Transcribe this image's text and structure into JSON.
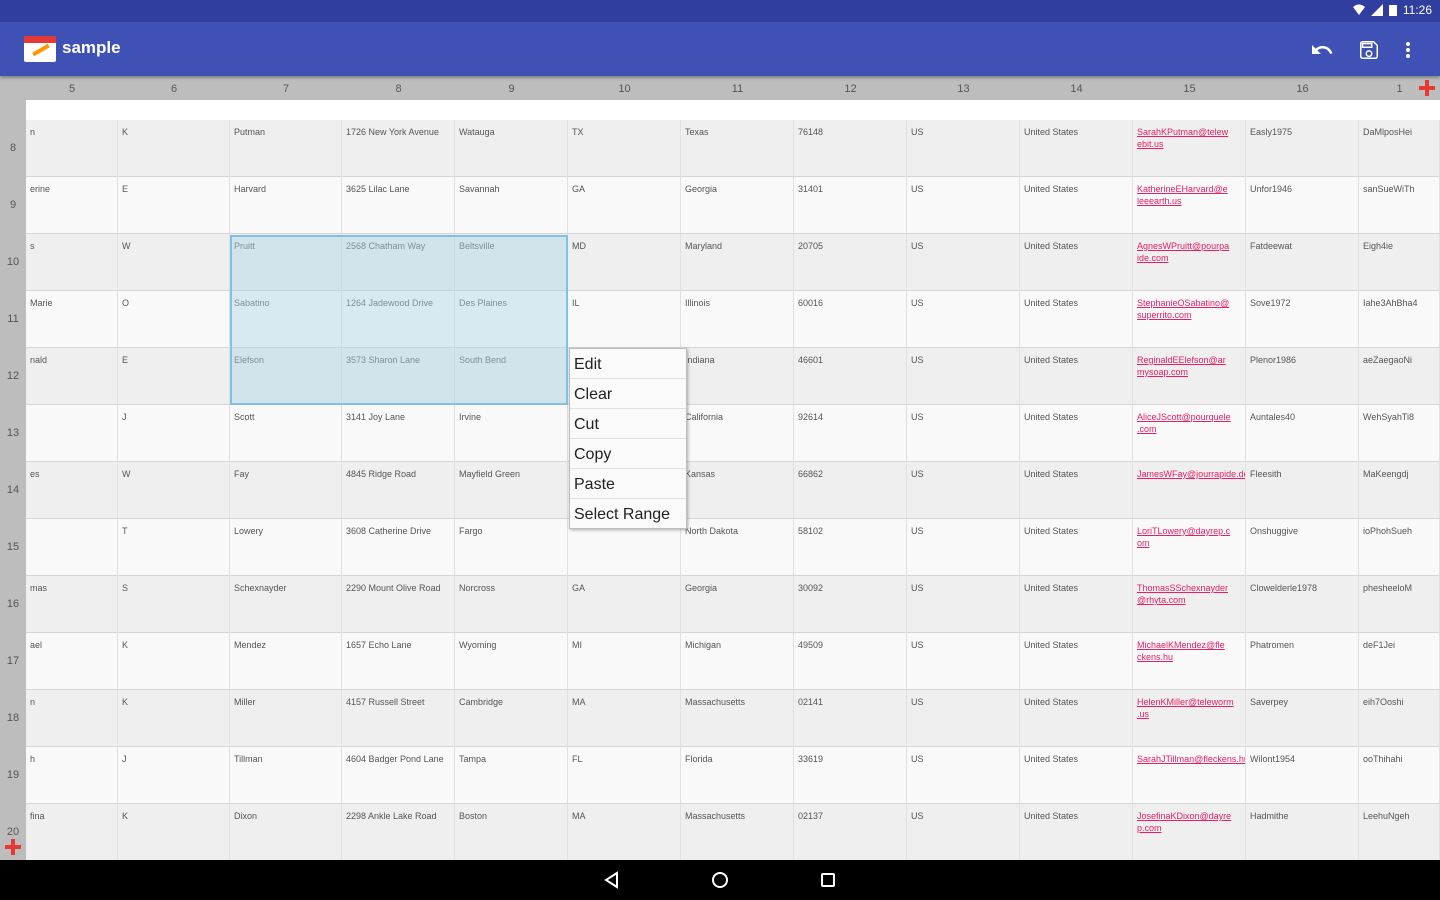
{
  "status_bar": {
    "time": "11:26"
  },
  "app": {
    "title": "sample"
  },
  "actions": [
    {
      "name": "undo-button",
      "icon": "undo-icon"
    },
    {
      "name": "save-button",
      "icon": "save-icon"
    },
    {
      "name": "overflow-menu-button",
      "icon": "more-vert-icon"
    }
  ],
  "columns": [
    "5",
    "6",
    "7",
    "8",
    "9",
    "10",
    "11",
    "12",
    "13",
    "14",
    "15",
    "16",
    "1"
  ],
  "rows": [
    {
      "num": "8",
      "cells": [
        "n",
        "K",
        "Putman",
        "1726 New York Avenue",
        "Watauga",
        "TX",
        "Texas",
        "76148",
        "US",
        "United States",
        "SarahKPutman@telew ebit.us",
        "Easly1975",
        "DaMlposHei"
      ]
    },
    {
      "num": "9",
      "cells": [
        "erine",
        "E",
        "Harvard",
        "3625 Lilac Lane",
        "Savannah",
        "GA",
        "Georgia",
        "31401",
        "US",
        "United States",
        "KatherineEHarvard@e leeearth.us",
        "Unfor1946",
        "sanSueWiTh"
      ]
    },
    {
      "num": "10",
      "cells": [
        "s",
        "W",
        "Pruitt",
        "2568 Chatham Way",
        "Beltsville",
        "MD",
        "Maryland",
        "20705",
        "US",
        "United States",
        "AgnesWPruitt@pourpa ide.com",
        "Fatdeewat",
        "Eigh4ie"
      ]
    },
    {
      "num": "11",
      "cells": [
        "Marie",
        "O",
        "Sabatino",
        "1264 Jadewood Drive",
        "Des Plaines",
        "IL",
        "Illinois",
        "60016",
        "US",
        "United States",
        "StephanieOSabatino@ superrito.com",
        "Sove1972",
        "Iahe3AhBha4"
      ]
    },
    {
      "num": "12",
      "cells": [
        "nald",
        "E",
        "Elefson",
        "3573 Sharon Lane",
        "South Bend",
        "",
        "Indiana",
        "46601",
        "US",
        "United States",
        "ReginaldEElefson@ar mysoap.com",
        "Plenor1986",
        "aeZaegaoNi"
      ]
    },
    {
      "num": "13",
      "cells": [
        "",
        "J",
        "Scott",
        "3141 Joy Lane",
        "Irvine",
        "",
        "California",
        "92614",
        "US",
        "United States",
        "AliceJScott@pourquele .com",
        "Auntales40",
        "WehSyahTi8"
      ]
    },
    {
      "num": "14",
      "cells": [
        "es",
        "W",
        "Fay",
        "4845 Ridge Road",
        "Mayfield Green",
        "",
        "Kansas",
        "66862",
        "US",
        "United States",
        "JamesWFay@jourrapide.de",
        "Fleesith",
        "MaKeengdj"
      ]
    },
    {
      "num": "15",
      "cells": [
        "",
        "T",
        "Lowery",
        "3608 Catherine Drive",
        "Fargo",
        "",
        "North Dakota",
        "58102",
        "US",
        "United States",
        "LoriTLowery@dayrep.c om",
        "Onshuggive",
        "ioPhohSueh"
      ]
    },
    {
      "num": "16",
      "cells": [
        "mas",
        "S",
        "Schexnayder",
        "2290 Mount Olive Road",
        "Norcross",
        "GA",
        "Georgia",
        "30092",
        "US",
        "United States",
        "ThomasSSchexnayder @rhyta.com",
        "Clowelderle1978",
        "phesheeloM"
      ]
    },
    {
      "num": "17",
      "cells": [
        "ael",
        "K",
        "Mendez",
        "1657 Echo Lane",
        "Wyoming",
        "MI",
        "Michigan",
        "49509",
        "US",
        "United States",
        "MichaelKMendez@fle ckens.hu",
        "Phatromen",
        "deF1Jei"
      ]
    },
    {
      "num": "18",
      "cells": [
        "n",
        "K",
        "Miller",
        "4157 Russell Street",
        "Cambridge",
        "MA",
        "Massachusetts",
        "02141",
        "US",
        "United States",
        "HelenKMiller@teleworm .us",
        "Saverpey",
        "eih7Ooshi"
      ]
    },
    {
      "num": "19",
      "cells": [
        "h",
        "J",
        "Tillman",
        "4604 Badger Pond Lane",
        "Tampa",
        "FL",
        "Florida",
        "33619",
        "US",
        "United States",
        "SarahJTillman@fleckens.hu",
        "Wilont1954",
        "ooThihahi"
      ]
    },
    {
      "num": "20",
      "cells": [
        "fina",
        "K",
        "Dixon",
        "2298 Ankle Lake Road",
        "Boston",
        "MA",
        "Massachusetts",
        "02137",
        "US",
        "United States",
        "JosefinaKDixon@dayre p.com",
        "Hadmithe",
        "LeehuNgeh"
      ]
    }
  ],
  "context_menu": [
    "Edit",
    "Clear",
    "Cut",
    "Copy",
    "Paste",
    "Select Range"
  ],
  "colors": {
    "app_bar": "#3f51b5",
    "status_bar": "#303f9f",
    "selection": "#add8e6",
    "email": "#e91e63",
    "add_icon": "#e53935"
  }
}
